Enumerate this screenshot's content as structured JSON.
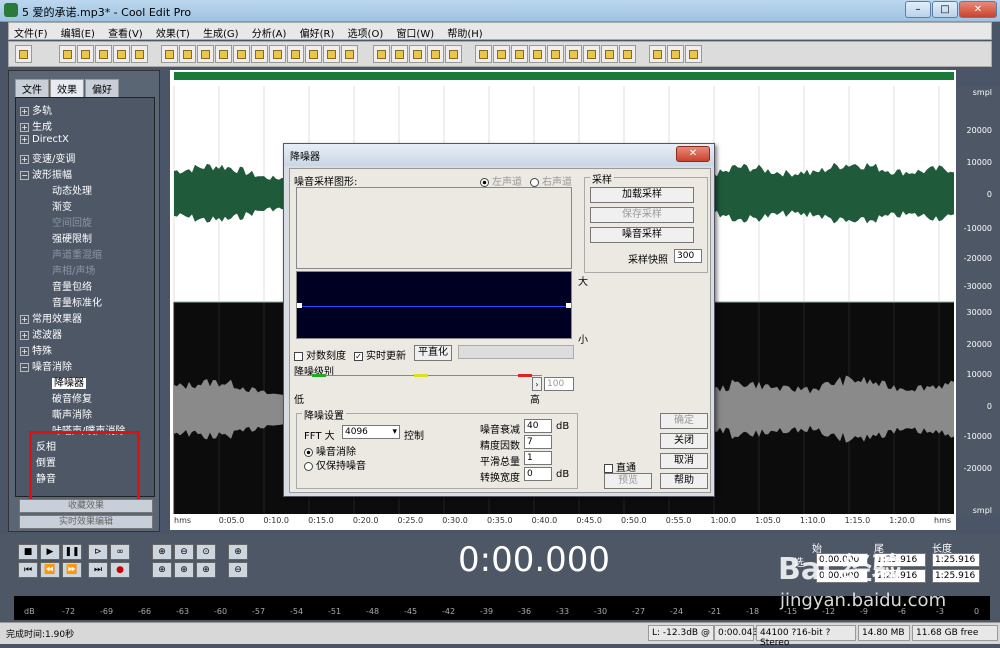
{
  "window": {
    "title": "5 爱的承诺.mp3* - Cool Edit Pro",
    "minimize": "–",
    "maximize": "□",
    "close": "✕"
  },
  "menu": [
    "文件(F)",
    "编辑(E)",
    "查看(V)",
    "效果(T)",
    "生成(G)",
    "分析(A)",
    "偏好(R)",
    "选项(O)",
    "窗口(W)",
    "帮助(H)"
  ],
  "left_tabs": [
    "文件",
    "效果",
    "偏好"
  ],
  "tree": {
    "top": [
      {
        "pm": "+",
        "label": "多轨"
      },
      {
        "pm": "+",
        "label": "生成"
      },
      {
        "pm": "+",
        "label": "DirectX"
      },
      {
        "pm": "+",
        "label": "变速/变调"
      },
      {
        "pm": "−",
        "label": "波形振幅"
      }
    ],
    "amp_children": [
      "动态处理",
      "渐变",
      "空间回旋",
      "强硬限制",
      "声道重混缩",
      "声相/声场",
      "音量包络",
      "音量标准化"
    ],
    "amp_dim": [
      false,
      false,
      true,
      false,
      true,
      true,
      false,
      false
    ],
    "mid": [
      {
        "pm": "+",
        "label": "常用效果器"
      },
      {
        "pm": "+",
        "label": "滤波器"
      },
      {
        "pm": "+",
        "label": "特殊"
      },
      {
        "pm": "−",
        "label": "噪音消除"
      }
    ],
    "noise_children": [
      "降噪器",
      "破音修复",
      "嘶声消除",
      "咔嗒声/噗声消除"
    ],
    "tail": [
      "反相",
      "倒置",
      "静音"
    ],
    "buttons": [
      "收藏效果",
      "实时效果编辑"
    ]
  },
  "ruler": [
    "smpl",
    "20000",
    "10000",
    "0",
    "-10000",
    "-20000",
    "-30000",
    "30000",
    "20000",
    "10000",
    "0",
    "-10000",
    "-20000",
    "smpl"
  ],
  "timeline": [
    "hms",
    "0:05.0",
    "0:10.0",
    "0:15.0",
    "0:20.0",
    "0:25.0",
    "0:30.0",
    "0:35.0",
    "0:40.0",
    "0:45.0",
    "0:50.0",
    "0:55.0",
    "1:00.0",
    "1:05.0",
    "1:10.0",
    "1:15.0",
    "1:20.0",
    "hms"
  ],
  "time_display": "0:00.000",
  "selection": {
    "headers": [
      "始",
      "尾",
      "长度"
    ],
    "row1_label": "选",
    "row1": [
      "0:00.000",
      "1:25.916",
      "1:25.916"
    ],
    "row2": [
      "0:00.000",
      "1:25.916",
      "1:25.916"
    ]
  },
  "level_ticks": [
    "dB",
    "-72",
    "-69",
    "-66",
    "-63",
    "-60",
    "-57",
    "-54",
    "-51",
    "-48",
    "-45",
    "-42",
    "-39",
    "-36",
    "-33",
    "-30",
    "-27",
    "-24",
    "-21",
    "-18",
    "-15",
    "-12",
    "-9",
    "-6",
    "-3",
    "0"
  ],
  "status": {
    "left": "完成时间:1.90秒",
    "level": "L: -12.3dB @",
    "pos": "0:00.043",
    "format": "44100 ?16-bit ?Stereo",
    "size": "14.80 MB",
    "free": "11.68 GB free"
  },
  "dialog": {
    "title": "降噪器",
    "close": "✕",
    "sample_graph_label": "噪音采样图形:",
    "left_channel": "左声道",
    "right_channel": "右声道",
    "big": "大",
    "small": "小",
    "log_scale": "对数刻度",
    "live_update": "实时更新",
    "flatten": "平直化",
    "noise_level_label": "降噪级别",
    "low": "低",
    "high": "高",
    "level_value": "100",
    "sample_group": "采样",
    "load_sample": "加载采样",
    "save_sample": "保存采样",
    "get_sample": "噪音采样",
    "snapshot_label": "采样快照",
    "snapshot_value": "300",
    "settings_group": "降噪设置",
    "fft_label": "FFT 大",
    "fft_value": "4096",
    "control": "控制",
    "mode1": "噪音消除",
    "mode2": "仅保持噪音",
    "reduce_label": "噪音衰减",
    "reduce_value": "40",
    "db": "dB",
    "precision_label": "精度因数",
    "precision_value": "7",
    "smooth_label": "平滑总量",
    "smooth_value": "1",
    "trans_label": "转换宽度",
    "trans_value": "0",
    "db2": "dB",
    "ok": "确定",
    "close_btn": "关闭",
    "cancel": "取消",
    "help": "帮助",
    "bypass": "直通",
    "preview": "预览"
  },
  "watermark": {
    "brand": "Bai 经验",
    "url": "jingyan.baidu.com"
  }
}
